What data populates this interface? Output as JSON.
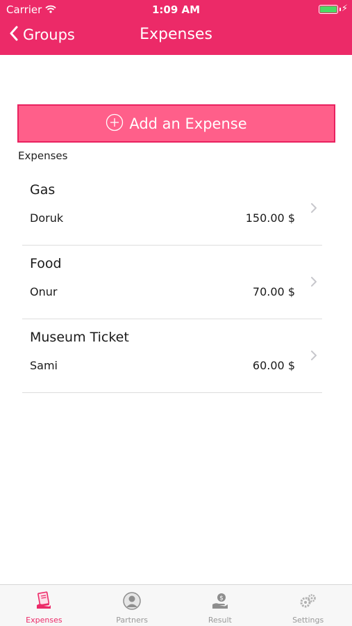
{
  "status_bar": {
    "carrier": "Carrier",
    "time": "1:09 AM"
  },
  "nav": {
    "back_label": "Groups",
    "title": "Expenses"
  },
  "add_button": {
    "label": "Add an Expense"
  },
  "section_label": "Expenses",
  "expenses": [
    {
      "title": "Gas",
      "person": "Doruk",
      "amount": "150.00 $"
    },
    {
      "title": "Food",
      "person": "Onur",
      "amount": "70.00 $"
    },
    {
      "title": "Museum Ticket",
      "person": "Sami",
      "amount": "60.00 $"
    }
  ],
  "tabs": [
    {
      "label": "Expenses",
      "icon": "receipt-icon",
      "active": true
    },
    {
      "label": "Partners",
      "icon": "person-icon",
      "active": false
    },
    {
      "label": "Result",
      "icon": "money-hand-icon",
      "active": false
    },
    {
      "label": "Settings",
      "icon": "gears-icon",
      "active": false
    }
  ],
  "colors": {
    "accent": "#ec2a68",
    "button": "#ff5f8a",
    "battery": "#4cd964",
    "tab_inactive": "#999999"
  }
}
